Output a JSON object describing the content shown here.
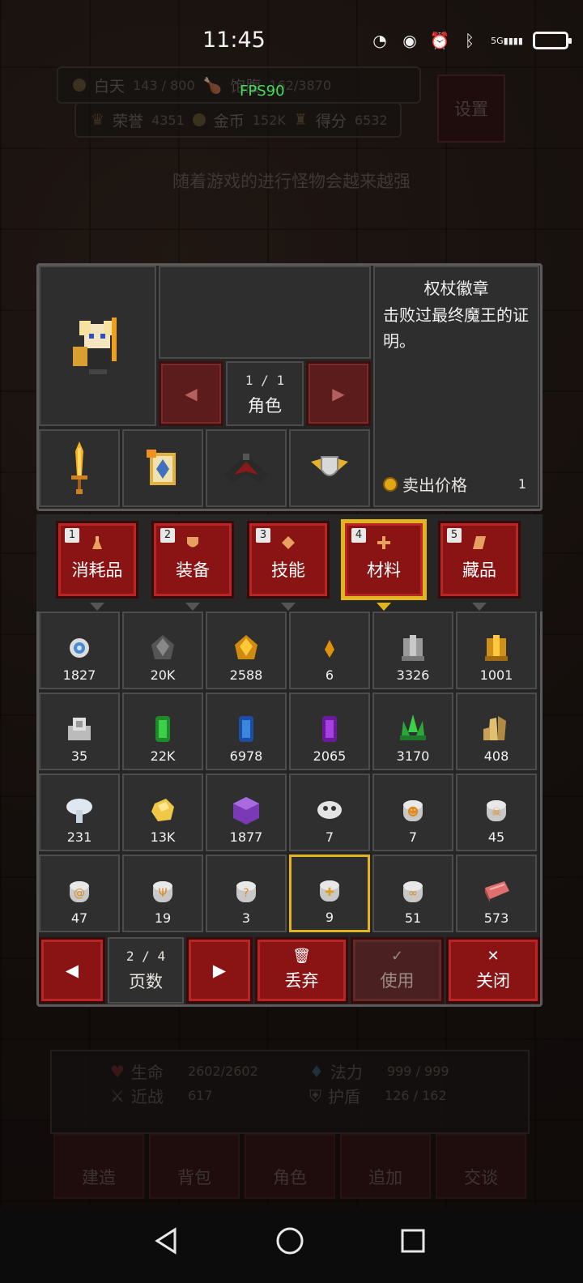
{
  "status_bar": {
    "time": "11:45",
    "network": "5G"
  },
  "fps": "FPS90",
  "hud": {
    "day_label": "白天",
    "day_value": "143 / 800",
    "hunger_label": "饱腹",
    "hunger_value": "162/3870",
    "honor_label": "荣誉",
    "honor_value": "4351",
    "gold_label": "金币",
    "gold_value": "152K",
    "score_label": "得分",
    "score_value": "6532",
    "settings_label": "设置",
    "hint": "随着游戏的进行怪物会越来越强"
  },
  "character": {
    "page": "1 / 1",
    "page_label": "角色"
  },
  "item_detail": {
    "name": "权杖徽章",
    "description": "击败过最终魔王的证明。",
    "price_label": "卖出价格",
    "price_value": "1"
  },
  "tabs": [
    {
      "num": "1",
      "label": "消耗品",
      "icon": "potion-icon"
    },
    {
      "num": "2",
      "label": "装备",
      "icon": "shield-icon"
    },
    {
      "num": "3",
      "label": "技能",
      "icon": "diamond-icon"
    },
    {
      "num": "4",
      "label": "材料",
      "icon": "plus-gem-icon",
      "active": true
    },
    {
      "num": "5",
      "label": "藏品",
      "icon": "scroll-icon"
    }
  ],
  "items": [
    {
      "icon": "eye-orb-icon",
      "qty": "1827"
    },
    {
      "icon": "coal-ore-icon",
      "qty": "20K"
    },
    {
      "icon": "gold-ore-icon",
      "qty": "2588"
    },
    {
      "icon": "amber-shard-icon",
      "qty": "6"
    },
    {
      "icon": "iron-ingot-icon",
      "qty": "3326"
    },
    {
      "icon": "gold-ingot-icon",
      "qty": "1001"
    },
    {
      "icon": "silver-ingot-icon",
      "qty": "35"
    },
    {
      "icon": "emerald-icon",
      "qty": "22K"
    },
    {
      "icon": "sapphire-icon",
      "qty": "6978"
    },
    {
      "icon": "amethyst-icon",
      "qty": "2065"
    },
    {
      "icon": "green-crystal-icon",
      "qty": "3170"
    },
    {
      "icon": "topaz-crystal-icon",
      "qty": "408"
    },
    {
      "icon": "mushroom-icon",
      "qty": "231"
    },
    {
      "icon": "gold-nugget-icon",
      "qty": "13K"
    },
    {
      "icon": "purple-cube-icon",
      "qty": "1877"
    },
    {
      "icon": "skull-stone-icon",
      "qty": "7"
    },
    {
      "icon": "rune-stone-orange-icon",
      "qty": "7"
    },
    {
      "icon": "rune-stone-skull-icon",
      "qty": "45"
    },
    {
      "icon": "rune-stone-spiral-icon",
      "qty": "47"
    },
    {
      "icon": "rune-stone-trident-icon",
      "qty": "19"
    },
    {
      "icon": "rune-stone-hook-icon",
      "qty": "3"
    },
    {
      "icon": "rune-stone-cross-icon",
      "qty": "9",
      "selected": true
    },
    {
      "icon": "rune-stone-bone-icon",
      "qty": "51"
    },
    {
      "icon": "raw-meat-icon",
      "qty": "573"
    }
  ],
  "controls": {
    "page": "2 / 4",
    "page_label": "页数",
    "discard": "丢弃",
    "use": "使用",
    "close": "关闭"
  },
  "stats": {
    "hp_label": "生命",
    "hp_value": "2602/2602",
    "mana_label": "法力",
    "mana_value": "999 / 999",
    "melee_label": "近战",
    "melee_value": "617",
    "shield_label": "护盾",
    "shield_value": "126 / 162"
  },
  "bottom_nav": [
    "建造",
    "背包",
    "角色",
    "追加",
    "交谈"
  ],
  "colors": {
    "accent_red": "#8a1414",
    "highlight_gold": "#e2b41e",
    "fps_green": "#3fe05a"
  }
}
